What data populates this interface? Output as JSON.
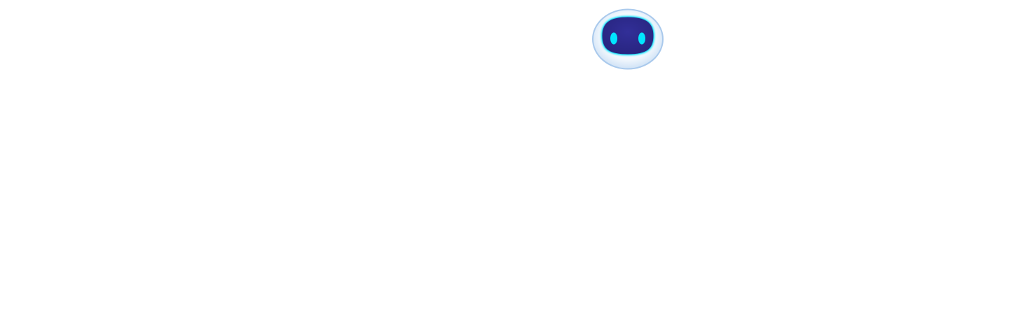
{
  "assistant": {
    "icon": "robot-face-icon",
    "colors": {
      "shell_outer": "#ffffff",
      "shell_edge": "#a9c9ec",
      "face": "#2e2c8f",
      "face_glow": "#00e5ff",
      "eyes": "#00e5ff"
    }
  }
}
